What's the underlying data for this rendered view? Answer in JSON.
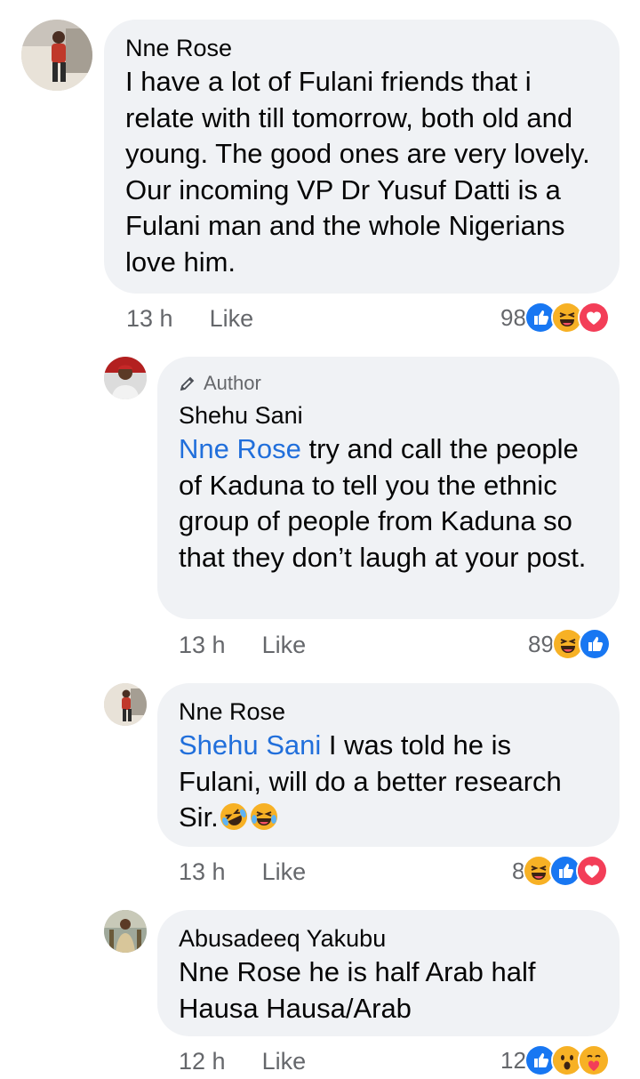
{
  "comments": [
    {
      "name": "Nne Rose",
      "text": "I have a lot of Fulani friends that i relate with till tomorrow, both old and young. The good ones are very lovely. Our incoming VP Dr Yusuf Datti is a Fulani man and the whole Nigerians love him.",
      "time": "13 h",
      "like_label": "Like",
      "reaction_count": "98",
      "reactions": [
        "like-reaction-icon",
        "haha-reaction-icon",
        "love-reaction-icon"
      ]
    },
    {
      "author_badge": "Author",
      "name": "Shehu Sani",
      "mention": "Nne Rose",
      "text": " try and call the people of Kaduna to tell you the ethnic group of people from Kaduna so that they don’t laugh at your post.",
      "time": "13 h",
      "like_label": "Like",
      "reaction_count": "89",
      "reactions": [
        "haha-reaction-icon",
        "like-reaction-icon"
      ]
    },
    {
      "name": "Nne Rose",
      "mention": "Shehu Sani",
      "text": " I was told he is Fulani, will do a better research Sir.",
      "emojis": [
        "rolling-laughing-emoji",
        "tears-of-joy-emoji"
      ],
      "time": "13 h",
      "like_label": "Like",
      "reaction_count": "8",
      "reactions": [
        "haha-reaction-icon",
        "like-reaction-icon",
        "love-reaction-icon"
      ]
    },
    {
      "name": "Abusadeeq Yakubu",
      "text": "Nne Rose  he is half Arab half Hausa Hausa/Arab",
      "time": "12 h",
      "like_label": "Like",
      "reaction_count": "12",
      "reactions": [
        "like-reaction-icon",
        "wow-reaction-icon",
        "care-reaction-icon"
      ]
    }
  ],
  "colors": {
    "bubble": "#f0f2f5",
    "mention": "#216fdb",
    "meta": "#65676b",
    "like": "#1877f2",
    "love": "#f33e58",
    "haha": "#f7b125"
  }
}
